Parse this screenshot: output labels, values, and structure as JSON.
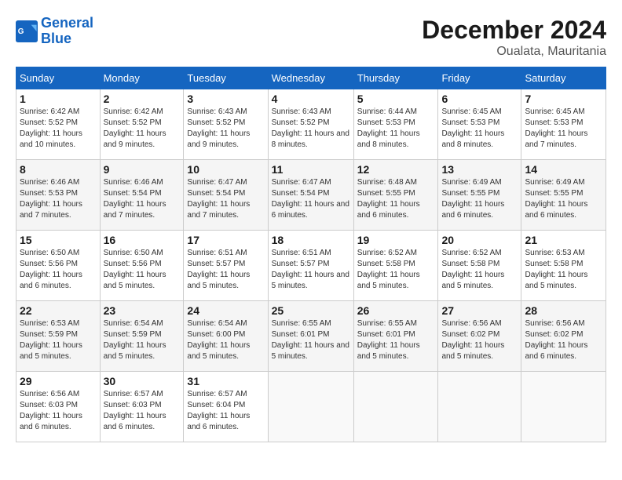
{
  "header": {
    "logo_line1": "General",
    "logo_line2": "Blue",
    "month": "December 2024",
    "location": "Oualata, Mauritania"
  },
  "days_of_week": [
    "Sunday",
    "Monday",
    "Tuesday",
    "Wednesday",
    "Thursday",
    "Friday",
    "Saturday"
  ],
  "weeks": [
    [
      {
        "day": "1",
        "sunrise": "6:42 AM",
        "sunset": "5:52 PM",
        "daylight": "11 hours and 10 minutes."
      },
      {
        "day": "2",
        "sunrise": "6:42 AM",
        "sunset": "5:52 PM",
        "daylight": "11 hours and 9 minutes."
      },
      {
        "day": "3",
        "sunrise": "6:43 AM",
        "sunset": "5:52 PM",
        "daylight": "11 hours and 9 minutes."
      },
      {
        "day": "4",
        "sunrise": "6:43 AM",
        "sunset": "5:52 PM",
        "daylight": "11 hours and 8 minutes."
      },
      {
        "day": "5",
        "sunrise": "6:44 AM",
        "sunset": "5:53 PM",
        "daylight": "11 hours and 8 minutes."
      },
      {
        "day": "6",
        "sunrise": "6:45 AM",
        "sunset": "5:53 PM",
        "daylight": "11 hours and 8 minutes."
      },
      {
        "day": "7",
        "sunrise": "6:45 AM",
        "sunset": "5:53 PM",
        "daylight": "11 hours and 7 minutes."
      }
    ],
    [
      {
        "day": "8",
        "sunrise": "6:46 AM",
        "sunset": "5:53 PM",
        "daylight": "11 hours and 7 minutes."
      },
      {
        "day": "9",
        "sunrise": "6:46 AM",
        "sunset": "5:54 PM",
        "daylight": "11 hours and 7 minutes."
      },
      {
        "day": "10",
        "sunrise": "6:47 AM",
        "sunset": "5:54 PM",
        "daylight": "11 hours and 7 minutes."
      },
      {
        "day": "11",
        "sunrise": "6:47 AM",
        "sunset": "5:54 PM",
        "daylight": "11 hours and 6 minutes."
      },
      {
        "day": "12",
        "sunrise": "6:48 AM",
        "sunset": "5:55 PM",
        "daylight": "11 hours and 6 minutes."
      },
      {
        "day": "13",
        "sunrise": "6:49 AM",
        "sunset": "5:55 PM",
        "daylight": "11 hours and 6 minutes."
      },
      {
        "day": "14",
        "sunrise": "6:49 AM",
        "sunset": "5:55 PM",
        "daylight": "11 hours and 6 minutes."
      }
    ],
    [
      {
        "day": "15",
        "sunrise": "6:50 AM",
        "sunset": "5:56 PM",
        "daylight": "11 hours and 6 minutes."
      },
      {
        "day": "16",
        "sunrise": "6:50 AM",
        "sunset": "5:56 PM",
        "daylight": "11 hours and 5 minutes."
      },
      {
        "day": "17",
        "sunrise": "6:51 AM",
        "sunset": "5:57 PM",
        "daylight": "11 hours and 5 minutes."
      },
      {
        "day": "18",
        "sunrise": "6:51 AM",
        "sunset": "5:57 PM",
        "daylight": "11 hours and 5 minutes."
      },
      {
        "day": "19",
        "sunrise": "6:52 AM",
        "sunset": "5:58 PM",
        "daylight": "11 hours and 5 minutes."
      },
      {
        "day": "20",
        "sunrise": "6:52 AM",
        "sunset": "5:58 PM",
        "daylight": "11 hours and 5 minutes."
      },
      {
        "day": "21",
        "sunrise": "6:53 AM",
        "sunset": "5:58 PM",
        "daylight": "11 hours and 5 minutes."
      }
    ],
    [
      {
        "day": "22",
        "sunrise": "6:53 AM",
        "sunset": "5:59 PM",
        "daylight": "11 hours and 5 minutes."
      },
      {
        "day": "23",
        "sunrise": "6:54 AM",
        "sunset": "5:59 PM",
        "daylight": "11 hours and 5 minutes."
      },
      {
        "day": "24",
        "sunrise": "6:54 AM",
        "sunset": "6:00 PM",
        "daylight": "11 hours and 5 minutes."
      },
      {
        "day": "25",
        "sunrise": "6:55 AM",
        "sunset": "6:01 PM",
        "daylight": "11 hours and 5 minutes."
      },
      {
        "day": "26",
        "sunrise": "6:55 AM",
        "sunset": "6:01 PM",
        "daylight": "11 hours and 5 minutes."
      },
      {
        "day": "27",
        "sunrise": "6:56 AM",
        "sunset": "6:02 PM",
        "daylight": "11 hours and 5 minutes."
      },
      {
        "day": "28",
        "sunrise": "6:56 AM",
        "sunset": "6:02 PM",
        "daylight": "11 hours and 6 minutes."
      }
    ],
    [
      {
        "day": "29",
        "sunrise": "6:56 AM",
        "sunset": "6:03 PM",
        "daylight": "11 hours and 6 minutes."
      },
      {
        "day": "30",
        "sunrise": "6:57 AM",
        "sunset": "6:03 PM",
        "daylight": "11 hours and 6 minutes."
      },
      {
        "day": "31",
        "sunrise": "6:57 AM",
        "sunset": "6:04 PM",
        "daylight": "11 hours and 6 minutes."
      },
      null,
      null,
      null,
      null
    ]
  ]
}
